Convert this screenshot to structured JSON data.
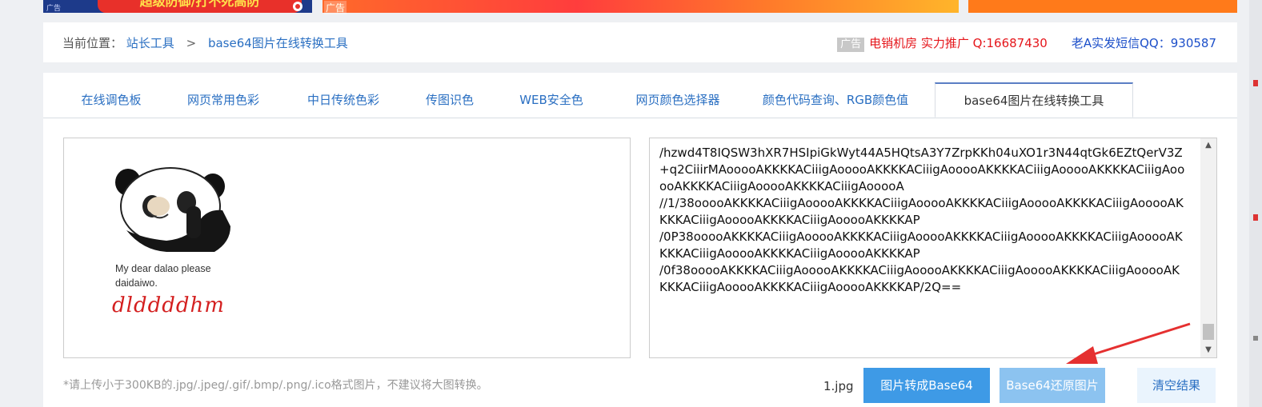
{
  "ads": {
    "left_tag": "广告",
    "left_text": "超级防御/打不死高防",
    "mid_tag": "广告"
  },
  "breadcrumb": {
    "label": "当前位置：",
    "home": "站长工具",
    "sep": ">",
    "current": "base64图片在线转换工具"
  },
  "ad_links": {
    "badge": "广告",
    "promo": "电销机房 实力推广 Q:16687430",
    "sms": "老A实发短信QQ：930587"
  },
  "tabs": [
    {
      "label": "在线调色板"
    },
    {
      "label": "网页常用色彩"
    },
    {
      "label": "中日传统色彩"
    },
    {
      "label": "传图识色"
    },
    {
      "label": "WEB安全色"
    },
    {
      "label": "网页颜色选择器"
    },
    {
      "label": "颜色代码查询、RGB颜色值"
    },
    {
      "label": "base64图片在线转换工具"
    }
  ],
  "preview": {
    "caption_line1": "My dear dalao please",
    "caption_line2": "daidaiwo.",
    "handwriting": "dlddddhm"
  },
  "output": {
    "text": "/hzwd4T8IQSW3hXR7HSIpiGkWyt44A5HQtsA3Y7ZrpKKh04uXO1r3N44qtGk6EZtQerV3Z+q2CiiirMAooooAKKKKACiiigAooooAKKKKACiiigAooooAKKKKACiiigAooooAKKKKACiiigAooooAKKKKACiiigAooooAKKKKACiiigAooooA\n//1/38ooooAKKKKACiiigAooooAKKKKACiiigAooooAKKKKACiiigAooooAKKKKACiiigAooooAKKKKACiiigAooooAKKKKACiiigAooooAKKKKAP\n/0P38ooooAKKKKACiiigAooooAKKKKACiiigAooooAKKKKACiiigAooooAKKKKACiiigAooooAKKKKACiiigAooooAKKKKACiiigAooooAKKKKAP\n/0f38ooooAKKKKACiiigAooooAKKKKACiiigAooooAKKKKACiiigAooooAKKKKACiiigAooooAKKKKACiiigAooooAKKKKACiiigAooooAKKKKAP/2Q=="
  },
  "hint": "*请上传小于300KB的.jpg/.jpeg/.gif/.bmp/.png/.ico格式图片，不建议将大图转换。",
  "filename": "1.jpg",
  "buttons": {
    "to_base64": "图片转成Base64",
    "restore": "Base64还原图片",
    "clear": "清空结果"
  },
  "colors": {
    "link": "#2a6fc2",
    "primary_button": "#3e9ae6",
    "secondary_button": "#8cc3f0",
    "ad_red": "#e5161b",
    "arrow": "#e53030"
  }
}
